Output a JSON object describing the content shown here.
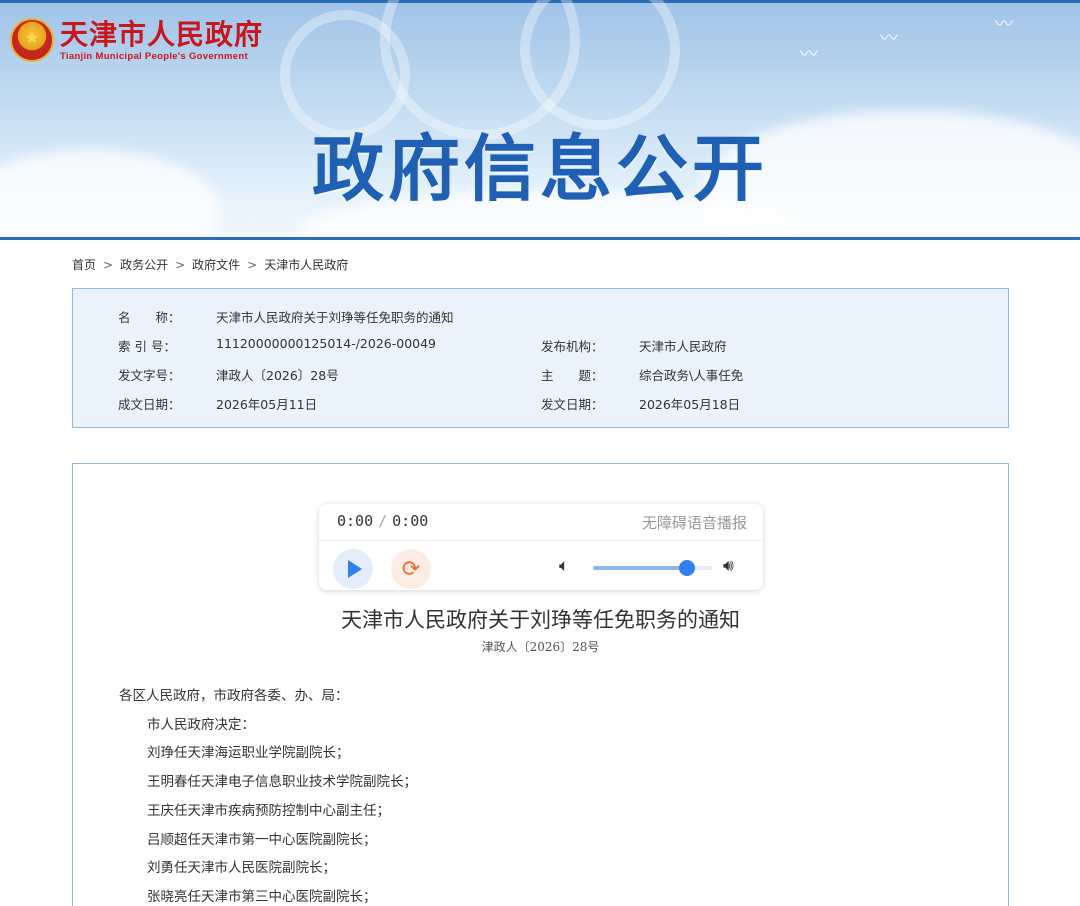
{
  "header": {
    "logo_cn": "天津市人民政府",
    "logo_en": "Tianjin Municipal People's Government",
    "title": "政府信息公开"
  },
  "breadcrumb": [
    "首页",
    "政务公开",
    "政府文件",
    "天津市人民政府"
  ],
  "meta": {
    "name_label": "名　　称：",
    "name": "天津市人民政府关于刘琤等任免职务的通知",
    "index_label": "索 引 号：",
    "index": "11120000000125014-/2026-00049",
    "publisher_label": "发布机构：",
    "publisher": "天津市人民政府",
    "doc_no_label": "发文字号：",
    "doc_no": "津政人〔2026〕28号",
    "topic_label": "主　　题：",
    "topic": "综合政务\\人事任免",
    "written_label": "成文日期：",
    "written": "2026年05月11日",
    "published_label": "发文日期：",
    "published": "2026年05月18日"
  },
  "player": {
    "current": "0:00",
    "separator": "/",
    "duration": "0:00",
    "tts_label": "无障碍语音播报",
    "volume": 0.78
  },
  "document": {
    "title": "天津市人民政府关于刘琤等任免职务的通知",
    "number": "津政人〔2026〕28号",
    "salutation": "各区人民政府，市政府各委、办、局：",
    "lines": [
      "市人民政府决定：",
      "刘琤任天津海运职业学院副院长；",
      "王明春任天津电子信息职业技术学院副院长；",
      "王庆任天津市疾病预防控制中心副主任；",
      "吕顺超任天津市第一中心医院副院长；",
      "刘勇任天津市人民医院副院长；",
      "张晓亮任天津市第三中心医院副院长；"
    ]
  },
  "colors": {
    "brand_red": "#c8161d",
    "brand_blue": "#1f5fb4",
    "accent_blue": "#2f80ed",
    "loop_orange": "#f06b2c"
  }
}
